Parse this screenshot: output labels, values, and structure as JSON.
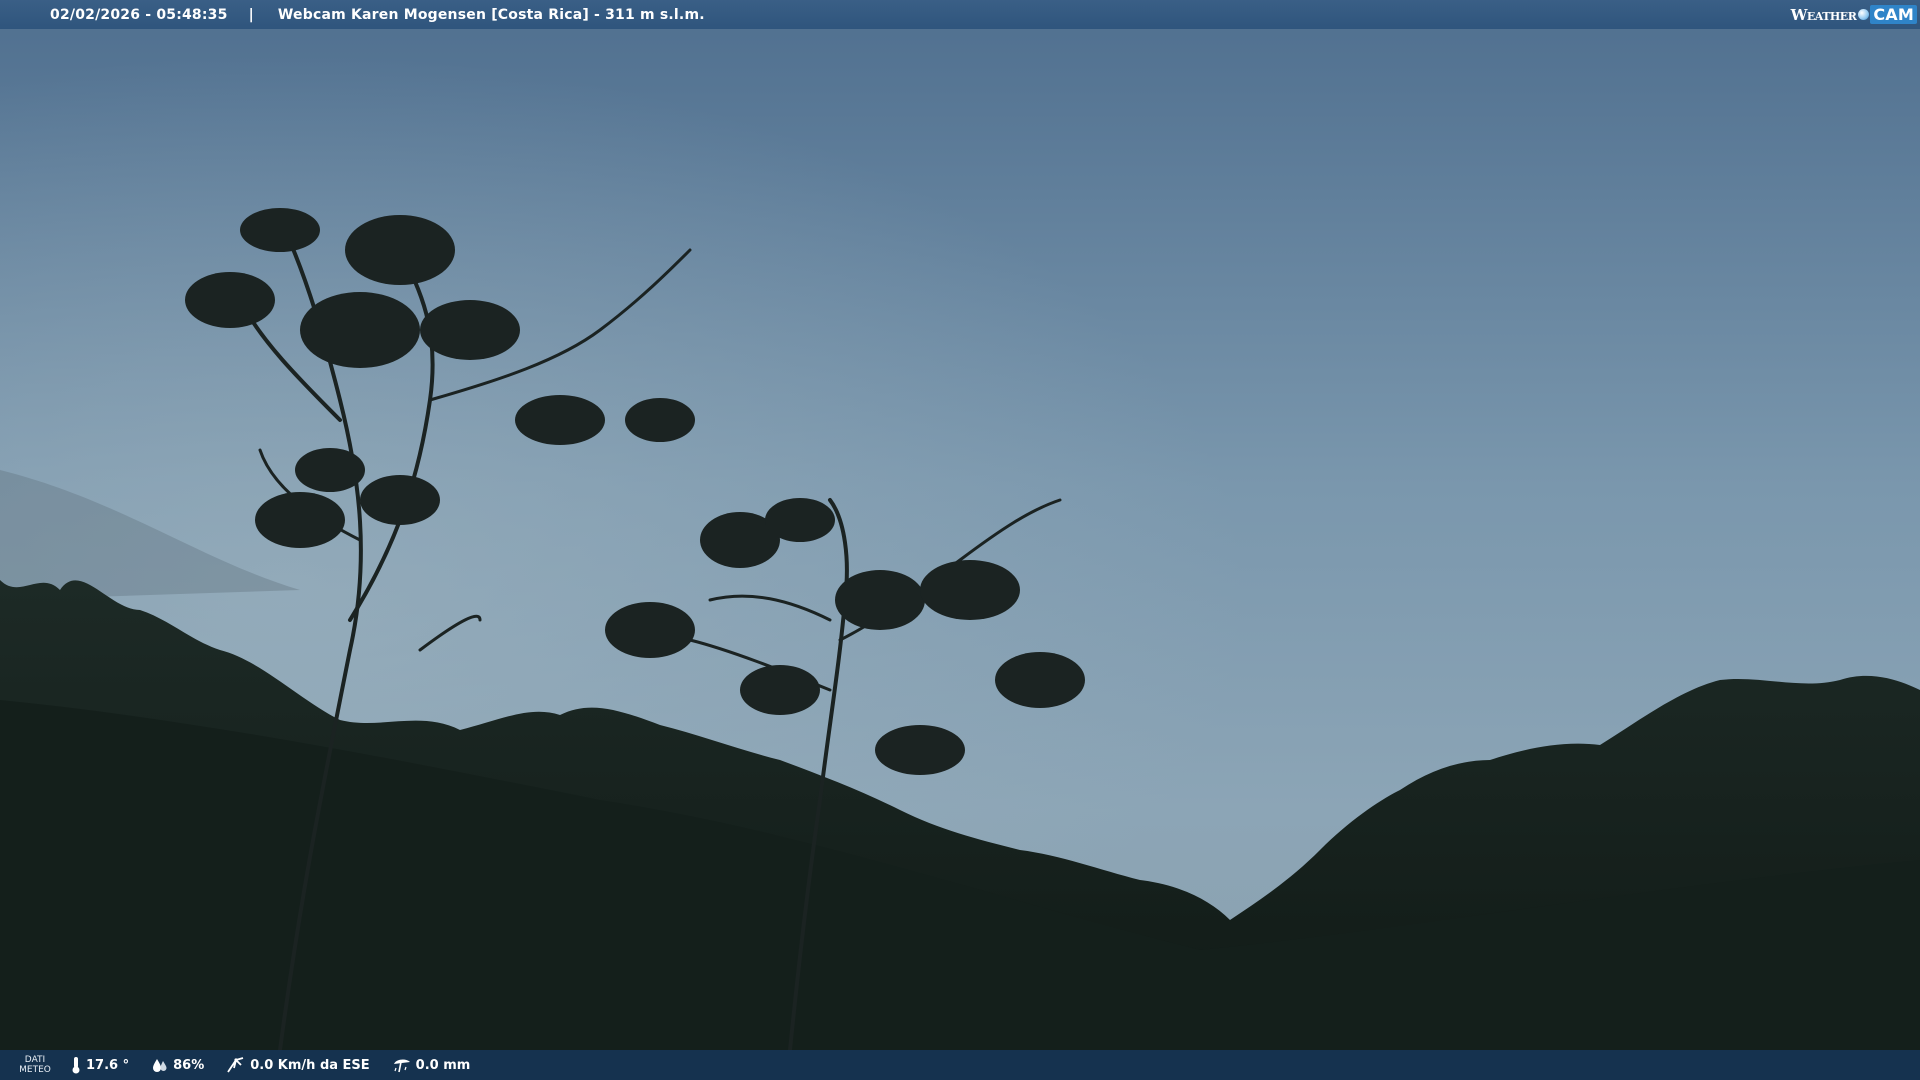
{
  "header": {
    "timestamp": "02/02/2026 - 05:48:35",
    "separator": "|",
    "title": "Webcam Karen Mogensen [Costa Rica]  - 311 m s.l.m."
  },
  "brand": {
    "weather": "Weather",
    "cam": "CAM"
  },
  "footer": {
    "dati_line1": "DATI",
    "dati_line2": "METEO",
    "temperature": "17.6 °",
    "humidity": "86%",
    "wind": "0.0 Km/h da ESE",
    "rain": "0.0 mm",
    "icons": {
      "temperature": "thermometer-icon",
      "humidity": "humidity-drop-icon",
      "wind": "wind-icon",
      "rain": "rain-gauge-icon"
    }
  },
  "colors": {
    "bar": "#2f557d",
    "brand_accent": "#2f84c8"
  }
}
